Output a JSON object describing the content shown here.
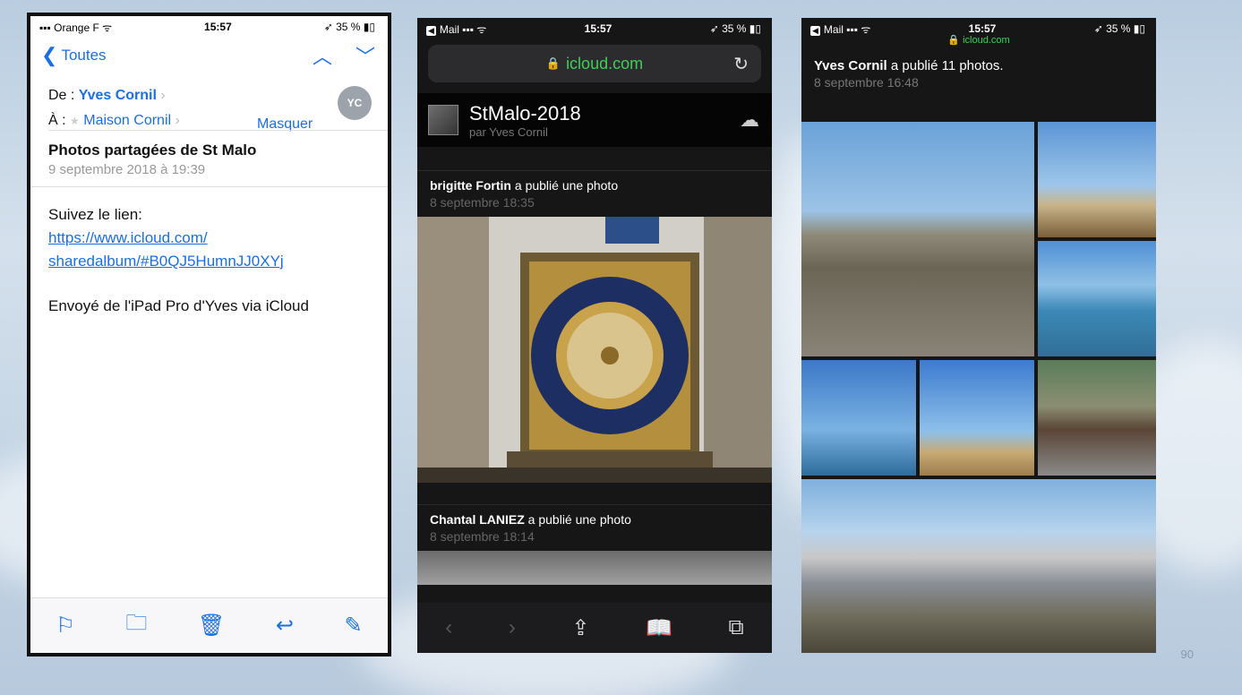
{
  "slide": {
    "page_number": "90"
  },
  "phone1": {
    "status": {
      "carrier": "Orange F",
      "time": "15:57",
      "battery": "35 %"
    },
    "nav": {
      "back_label": "Toutes"
    },
    "header": {
      "from_label": "De :",
      "from_name": "Yves Cornil",
      "to_label": "À :",
      "to_name": "Maison Cornil",
      "hide_label": "Masquer",
      "avatar_initials": "YC",
      "subject": "Photos partagées de St Malo",
      "date": "9 septembre 2018 à 19:39"
    },
    "body": {
      "intro": "Suivez le lien:",
      "link_line1": "https://www.icloud.com/",
      "link_line2": "sharedalbum/#B0QJ5HumnJJ0XYj",
      "signature": "Envoyé de l'iPad Pro d'Yves via iCloud"
    },
    "toolbar_icons": [
      "flag-icon",
      "folder-icon",
      "trash-icon",
      "reply-icon",
      "compose-icon"
    ]
  },
  "phone2": {
    "status": {
      "back_app": "Mail",
      "time": "15:57",
      "battery": "35 %"
    },
    "url": "icloud.com",
    "album": {
      "title": "StMalo-2018",
      "subtitle": "par Yves Cornil"
    },
    "posts": [
      {
        "author": "brigitte Fortin",
        "action": "a publié une photo",
        "date": "8 septembre 18:35"
      },
      {
        "author": "Chantal LANIEZ",
        "action": "a publié une photo",
        "date": "8 septembre 18:14"
      }
    ]
  },
  "phone3": {
    "status": {
      "back_app": "Mail",
      "time": "15:57",
      "battery": "35 %"
    },
    "url": "icloud.com",
    "post": {
      "author": "Yves Cornil",
      "action": "a publié 11 photos.",
      "date": "8 septembre 16:48"
    }
  },
  "colors": {
    "accent_blue": "#1b6fe0",
    "url_green": "#3fcf59"
  }
}
